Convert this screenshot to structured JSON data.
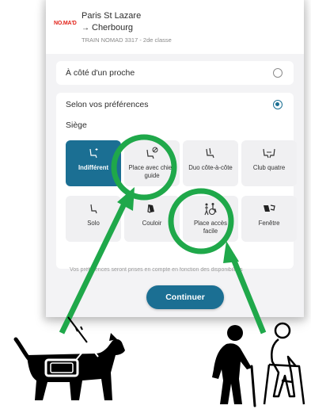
{
  "trip": {
    "brand": "NO.MA'D",
    "origin": "Paris St Lazare",
    "arrow": "→",
    "destination": "Cherbourg",
    "info": "TRAIN NOMAD 3317 - 2de classe"
  },
  "options": {
    "proche_label": "À côté d'un proche",
    "pref_label": "Selon vos préférences"
  },
  "siege": {
    "label": "Siège",
    "tiles": [
      {
        "label": "Indifférent",
        "icon": "seat-sparkle-icon",
        "selected": true
      },
      {
        "label": "Place avec chien guide",
        "icon": "seat-no-icon",
        "selected": false
      },
      {
        "label": "Duo côte-à-côte",
        "icon": "double-seat-icon",
        "selected": false
      },
      {
        "label": "Club quatre",
        "icon": "facing-seats-icon",
        "selected": false
      },
      {
        "label": "Solo",
        "icon": "single-seat-icon",
        "selected": false
      },
      {
        "label": "Couloir",
        "icon": "aisle-seat-icon",
        "selected": false
      },
      {
        "label": "Place accès facile",
        "icon": "accessibility-icon",
        "selected": false
      },
      {
        "label": "Fenêtre",
        "icon": "window-seat-icon",
        "selected": false
      }
    ]
  },
  "notice": "Vos préférences seront prises en compte en fonction des disponibilités",
  "continue_label": "Continuer",
  "colors": {
    "accent": "#1b6f93",
    "highlight": "#1fa84a",
    "brand": "#e2231a"
  }
}
